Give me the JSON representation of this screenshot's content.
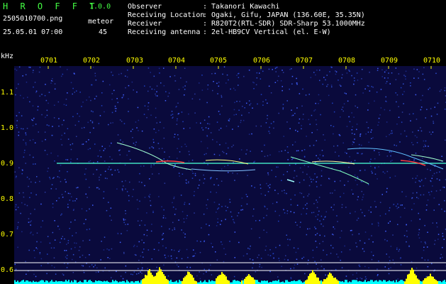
{
  "header": {
    "app_name": "H R O F F T",
    "version": "1.0.0",
    "filename": "2505010700.png",
    "datetime": "25.05.01 07:00",
    "meteor_label": "meteor",
    "meteor_count": "45"
  },
  "station": [
    {
      "label": "Observer",
      "value": ": Takanori Kawachi"
    },
    {
      "label": "Receiving Location",
      "value": ": Ogaki, Gifu, JAPAN (136.60E, 35.35N)"
    },
    {
      "label": "Receiver",
      "value": ": R820T2(RTL-SDR) SDR-Sharp 53.1000MHz"
    },
    {
      "label": "Receiving antenna",
      "value": ": 2el-HB9CV Vertical (el. E-W)"
    }
  ],
  "y_axis": {
    "unit": "kHz",
    "ticks": [
      "1.1",
      "1.0",
      "0.9",
      "0.8",
      "0.7",
      "0.6"
    ]
  },
  "x_axis": {
    "ticks": [
      "0701",
      "0702",
      "0703",
      "0704",
      "0705",
      "0706",
      "0707",
      "0708",
      "0709",
      "0710"
    ]
  },
  "colors": {
    "background": "#0a0a3c",
    "carrier": "#40e0c0",
    "trail": "#a0ffd0",
    "head": "#ff4040",
    "label_yellow": "#ffff00",
    "title_green": "#44ff44",
    "power_cyan": "#00ffff",
    "power_yellow": "#ffff00"
  }
}
